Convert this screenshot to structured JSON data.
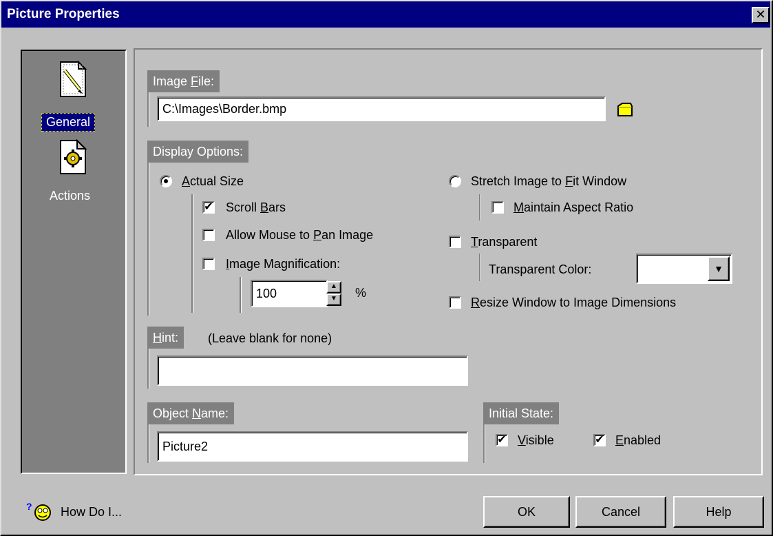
{
  "window": {
    "title": "Picture Properties",
    "close_glyph": "✕"
  },
  "sidebar": {
    "items": [
      {
        "label": "General",
        "icon": "pencil-page-icon",
        "selected": true
      },
      {
        "label": "Actions",
        "icon": "gear-page-icon",
        "selected": false
      }
    ]
  },
  "image_file": {
    "caption_pre": "Image ",
    "caption_key": "F",
    "caption_post": "ile:",
    "value": "C:\\Images\\Border.bmp",
    "browse_icon": "folder-icon"
  },
  "display_options": {
    "caption": "Display Options:",
    "actual_size": {
      "key": "A",
      "rest": "ctual Size",
      "selected": true
    },
    "scroll_bars": {
      "pre": "Scroll ",
      "key": "B",
      "post": "ars",
      "checked": true
    },
    "allow_pan": {
      "pre": "Allow Mouse to ",
      "key": "P",
      "post": "an Image",
      "checked": false
    },
    "magnification": {
      "key": "I",
      "post": "mage Magnification:",
      "checked": false,
      "value": "100",
      "unit": "%"
    },
    "stretch": {
      "pre": "Stretch Image to ",
      "key": "F",
      "post": "it Window",
      "selected": false
    },
    "aspect": {
      "key": "M",
      "post": "aintain Aspect Ratio",
      "checked": false
    },
    "transparent": {
      "key": "T",
      "post": "ransparent",
      "checked": false
    },
    "transparent_color_label": "Transparent Color:",
    "transparent_color_value": "",
    "resize": {
      "key": "R",
      "post": "esize Window to Image Dimensions",
      "checked": false
    }
  },
  "hint": {
    "key": "H",
    "post": "int:",
    "note": "(Leave blank for none)",
    "value": ""
  },
  "object_name": {
    "pre": "Object ",
    "key": "N",
    "post": "ame:",
    "value": "Picture2"
  },
  "initial_state": {
    "caption": "Initial State:",
    "visible": {
      "key": "V",
      "post": "isible",
      "checked": true
    },
    "enabled": {
      "key": "E",
      "post": "nabled",
      "checked": true
    }
  },
  "footer": {
    "how_do_i": "How Do I...",
    "ok": "OK",
    "cancel": "Cancel",
    "help": "Help"
  },
  "check_glyph": "✔"
}
